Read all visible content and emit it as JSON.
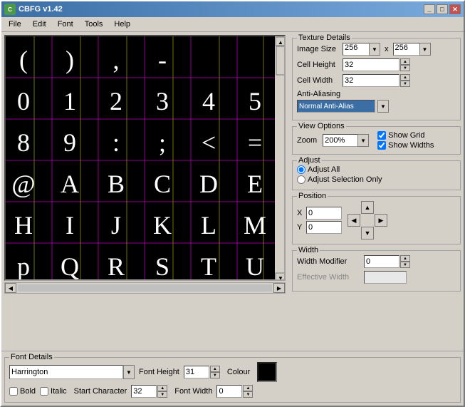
{
  "window": {
    "title": "CBFG v1.42",
    "icon": "C"
  },
  "menu": {
    "items": [
      "File",
      "Edit",
      "Font",
      "Tools",
      "Help"
    ]
  },
  "texture_details": {
    "title": "Texture Details",
    "image_size_label": "Image Size",
    "image_size_x": "256",
    "image_size_x2": "256",
    "x_separator": "x",
    "cell_height_label": "Cell Height",
    "cell_height_value": "32",
    "cell_width_label": "Cell Width",
    "cell_width_value": "32",
    "anti_alias_label": "Anti-Aliasing",
    "anti_alias_value": "Normal Anti-Alias"
  },
  "view_options": {
    "title": "View Options",
    "zoom_label": "Zoom",
    "zoom_value": "200%",
    "show_grid_label": "Show Grid",
    "show_widths_label": "Show Widths",
    "show_grid_checked": true,
    "show_widths_checked": true
  },
  "adjust": {
    "title": "Adjust",
    "adjust_all_label": "Adjust All",
    "adjust_selection_label": "Adjust Selection Only"
  },
  "position": {
    "title": "Position",
    "x_label": "X",
    "x_value": "0",
    "y_label": "Y",
    "y_value": "0"
  },
  "width": {
    "title": "Width",
    "modifier_label": "Width Modifier",
    "modifier_value": "0",
    "effective_label": "Effective Width",
    "effective_value": ""
  },
  "font_details": {
    "title": "Font Details",
    "font_name": "Harrington",
    "font_height_label": "Font Height",
    "font_height_value": "31",
    "colour_label": "Colour",
    "bold_label": "Bold",
    "italic_label": "Italic",
    "start_char_label": "Start Character",
    "start_char_value": "32",
    "font_width_label": "Font Width",
    "font_width_value": "0"
  },
  "chars": [
    "(",
    ")",
    ",",
    "-",
    "0",
    "1",
    "2",
    "3",
    "4",
    "5",
    "8",
    "9",
    ":",
    ";",
    "<",
    "=",
    "@",
    "A",
    "B",
    "C",
    "D",
    "E",
    "H",
    "I",
    "J",
    "K",
    "L",
    "M",
    "p",
    "Q",
    "R",
    "S",
    "T",
    "U"
  ],
  "scrollbar": {
    "left_arrow": "◀",
    "right_arrow": "▶",
    "up_arrow": "▲",
    "down_arrow": "▼"
  }
}
